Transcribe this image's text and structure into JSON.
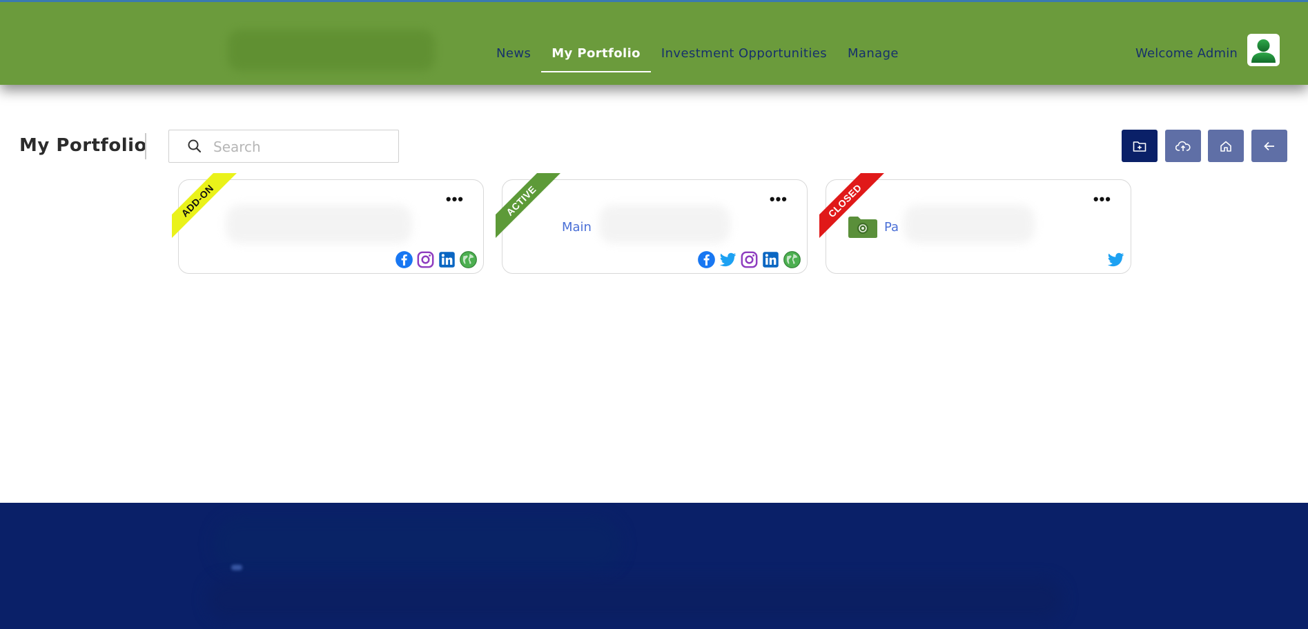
{
  "nav": {
    "items": [
      {
        "label": "News",
        "active": false
      },
      {
        "label": "My Portfolio",
        "active": true
      },
      {
        "label": "Investment Opportunities",
        "active": false
      },
      {
        "label": "Manage",
        "active": false
      }
    ],
    "welcome": "Welcome Admin"
  },
  "page": {
    "title": "My Portfolio",
    "search_placeholder": "Search"
  },
  "toolbar": {
    "buttons": [
      "add-folder",
      "cloud-upload",
      "home",
      "back"
    ]
  },
  "cards": [
    {
      "ribbon": "ADD-ON",
      "ribbon_color": "#eaf21a",
      "name": "",
      "socials": [
        "facebook",
        "instagram",
        "linkedin",
        "website"
      ]
    },
    {
      "ribbon": "ACTIVE",
      "ribbon_color": "#5d9a38",
      "name": "Main",
      "socials": [
        "facebook",
        "twitter",
        "instagram",
        "linkedin",
        "website"
      ]
    },
    {
      "ribbon": "CLOSED",
      "ribbon_color": "#e01919",
      "name": "Pa",
      "socials": [
        "twitter"
      ]
    }
  ],
  "colors": {
    "header": "#6b9b3c",
    "footer": "#0a2068",
    "nav_text": "#16306b",
    "link": "#4a6fd6"
  }
}
